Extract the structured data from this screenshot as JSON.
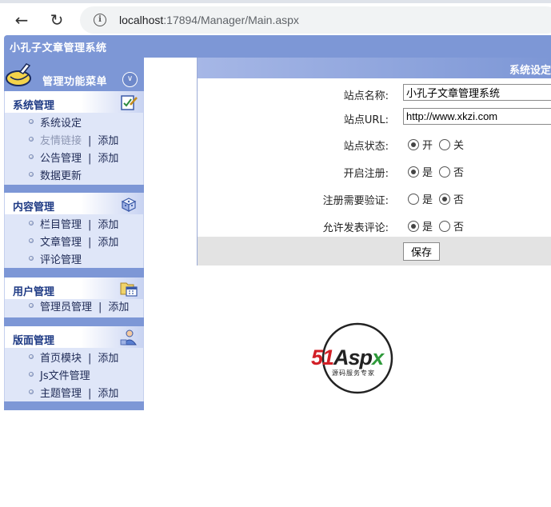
{
  "browser": {
    "url_host": "localhost",
    "url_rest": ":17894/Manager/Main.aspx"
  },
  "app": {
    "title": "小孔子文章管理系统"
  },
  "sidebar": {
    "menu_title": "管理功能菜单",
    "groups": [
      {
        "title": "系统管理",
        "icon": "edit-icon",
        "items": [
          {
            "label": "系统设定"
          },
          {
            "label": "友情链接",
            "disabled": true,
            "action": "添加"
          },
          {
            "label": "公告管理",
            "action": "添加"
          },
          {
            "label": "数据更新"
          }
        ]
      },
      {
        "title": "内容管理",
        "icon": "dice-icon",
        "items": [
          {
            "label": "栏目管理",
            "action": "添加"
          },
          {
            "label": "文章管理",
            "action": "添加"
          },
          {
            "label": "评论管理"
          }
        ]
      },
      {
        "title": "用户管理",
        "icon": "calendar-folder-icon",
        "items": [
          {
            "label": "管理员管理",
            "action": "添加"
          }
        ]
      },
      {
        "title": "版面管理",
        "icon": "user-icon",
        "items": [
          {
            "label": "首页模块",
            "action": "添加"
          },
          {
            "label": "Js文件管理"
          },
          {
            "label": "主题管理",
            "action": "添加"
          }
        ]
      }
    ],
    "separator": "|"
  },
  "settings": {
    "title": "系统设定",
    "site_name_label": "站点名称:",
    "site_name_value": "小孔子文章管理系统",
    "site_url_label": "站点URL:",
    "site_url_value": "http://www.xkzi.com",
    "site_status_label": "站点状态:",
    "site_status_options": [
      "开",
      "关"
    ],
    "site_status_selected": "开",
    "registration_label": "开启注册:",
    "registration_options": [
      "是",
      "否"
    ],
    "registration_selected": "是",
    "reg_verify_label": "注册需要验证:",
    "reg_verify_options": [
      "是",
      "否"
    ],
    "reg_verify_selected": "否",
    "allow_comment_label": "允许发表评论:",
    "allow_comment_options": [
      "是",
      "否"
    ],
    "allow_comment_selected": "是",
    "save_label": "保存"
  },
  "logo": {
    "brand": "51Aspx",
    "tagline": "源码服务专家"
  }
}
